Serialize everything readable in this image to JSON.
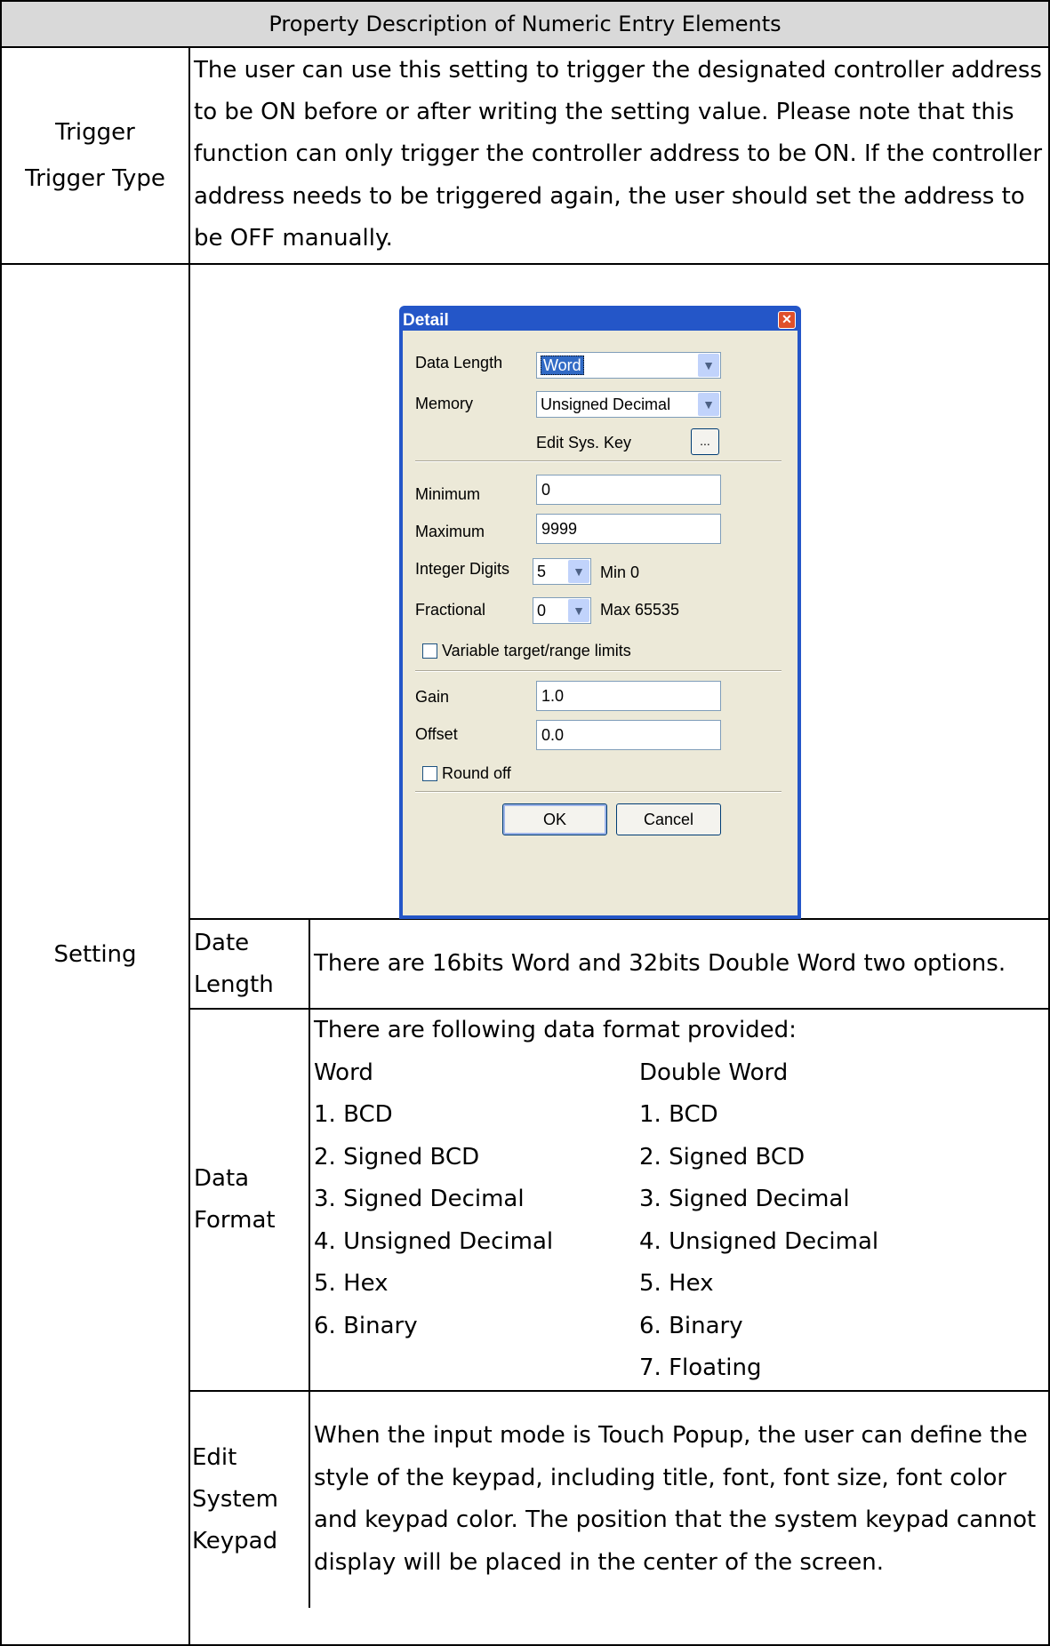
{
  "header": "Property Description of Numeric Entry Elements",
  "trigger": {
    "label_line1": "Trigger",
    "label_line2": "Trigger Type",
    "description": "The user can use this setting to trigger the designated controller address to be ON before or after writing the setting value. Please note that this function can only trigger the controller address to be ON. If the controller address needs to be triggered again, the user should set the address to be OFF manually."
  },
  "setting": {
    "label": "Setting",
    "dialog": {
      "title": "Detail",
      "close_icon": "close-icon",
      "data_length_label": "Data Length",
      "data_length_value": "Word",
      "memory_label": "Memory",
      "memory_value": "Unsigned Decimal",
      "edit_sys_key_label": "Edit Sys. Key",
      "edit_sys_key_button": "...",
      "minimum_label": "Minimum",
      "minimum_value": "0",
      "maximum_label": "Maximum",
      "maximum_value": "9999",
      "integer_digits_label": "Integer Digits",
      "integer_digits_value": "5",
      "min_text": "Min 0",
      "fractional_label": "Fractional",
      "fractional_value": "0",
      "max_text": "Max 65535",
      "variable_limits_label": "Variable target/range limits",
      "variable_limits_checked": false,
      "gain_label": "Gain",
      "gain_value": "1.0",
      "offset_label": "Offset",
      "offset_value": "0.0",
      "round_off_label": "Round off",
      "round_off_checked": false,
      "ok_button": "OK",
      "cancel_button": "Cancel"
    },
    "date_length": {
      "label_line1": "Date",
      "label_line2": "Length",
      "description": "There are 16bits Word and 32bits Double Word two options."
    },
    "data_format": {
      "label_line1": "Data",
      "label_line2": "Format",
      "intro": "There are following data format provided:",
      "word_heading": "Word",
      "double_word_heading": "Double Word",
      "word_items": [
        "1.  BCD",
        "2.  Signed BCD",
        "3.  Signed Decimal",
        "4.  Unsigned Decimal",
        "5.  Hex",
        "6.  Binary"
      ],
      "double_word_items": [
        "1.  BCD",
        "2.  Signed BCD",
        "3.  Signed Decimal",
        "4.  Unsigned Decimal",
        "5.  Hex",
        "6.  Binary",
        "7.  Floating"
      ]
    },
    "edit_keypad": {
      "label_line1": "Edit System",
      "label_line2": "Keypad",
      "description": "When the input mode is Touch Popup, the user can define the style of the keypad, including title, font, font size, font color and keypad color. The position that the system keypad cannot display will be placed in the center of the screen."
    }
  }
}
